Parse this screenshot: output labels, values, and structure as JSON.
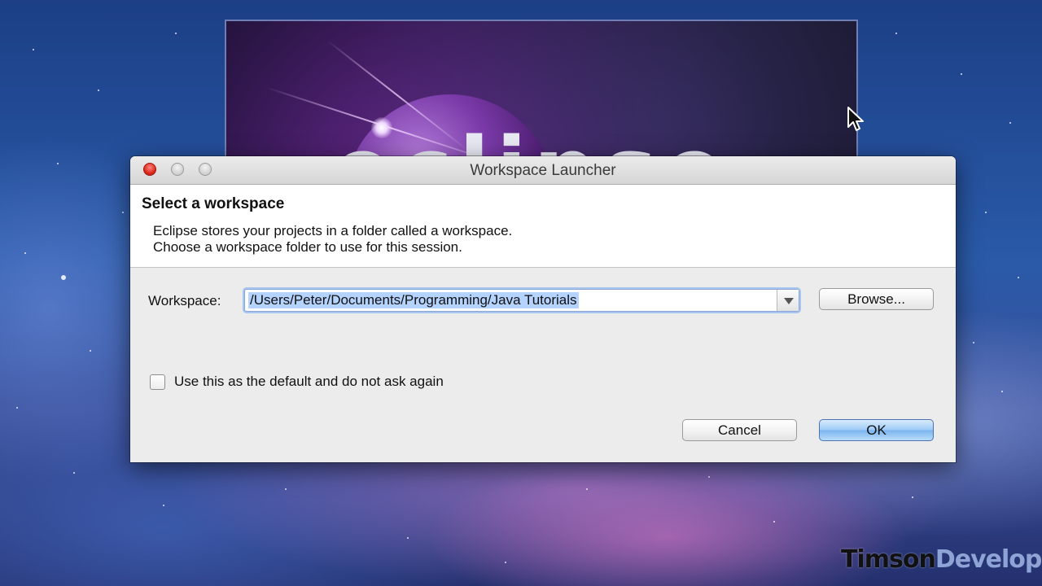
{
  "splash": {
    "logo_text": "eclipse"
  },
  "dialog": {
    "title": "Workspace Launcher",
    "header_title": "Select a workspace",
    "description_line1": "Eclipse stores your projects in a folder called a workspace.",
    "description_line2": "Choose a workspace folder to use for this session.",
    "workspace_label": "Workspace:",
    "workspace_value": "/Users/Peter/Documents/Programming/Java Tutorials",
    "browse_label": "Browse...",
    "default_checkbox_label": "Use this as the default and do not ask again",
    "default_checked": false,
    "cancel_label": "Cancel",
    "ok_label": "OK"
  },
  "watermark": {
    "part1": "Timson",
    "part2": "Develop"
  },
  "colors": {
    "ok_button": "#9ccaf6",
    "selection": "#b5d3ff",
    "close_button": "#e0281e"
  }
}
